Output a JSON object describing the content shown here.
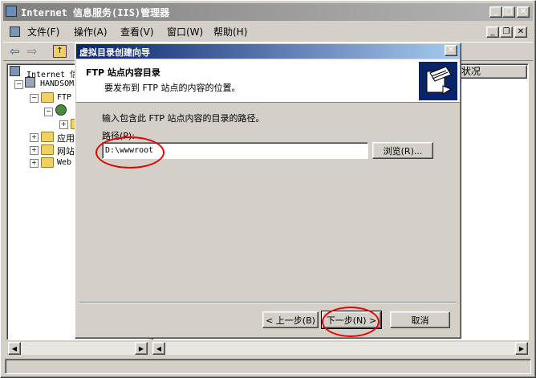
{
  "app": {
    "title": "Internet 信息服务(IIS)管理器"
  },
  "menu": {
    "items": [
      "文件(F)",
      "操作(A)",
      "查看(V)",
      "窗口(W)",
      "帮助(H)"
    ]
  },
  "tree": {
    "root": "Internet 信",
    "server": "HANDSOM",
    "ftp": "FTP",
    "apps": "应用",
    "sites": "网站",
    "web": "Web"
  },
  "right_pane": {
    "column_header": "状况"
  },
  "dialog": {
    "title": "虚拟目录创建向导",
    "header_title": "FTP 站点内容目录",
    "header_subtitle": "要发布到 FTP 站点的内容的位置。",
    "instruction": "输入包含此 FTP 站点内容的目录的路径。",
    "path_label": "路径(P):",
    "path_value": "D:\\wwwroot",
    "browse_label": "浏览(R)...",
    "back_label": "< 上一步(B)",
    "next_label": "下一步(N) >",
    "cancel_label": "取消"
  },
  "colors": {
    "dialog_title_start": "#0a246a",
    "dialog_title_end": "#a6caf0",
    "annotation_red": "#e00000"
  }
}
